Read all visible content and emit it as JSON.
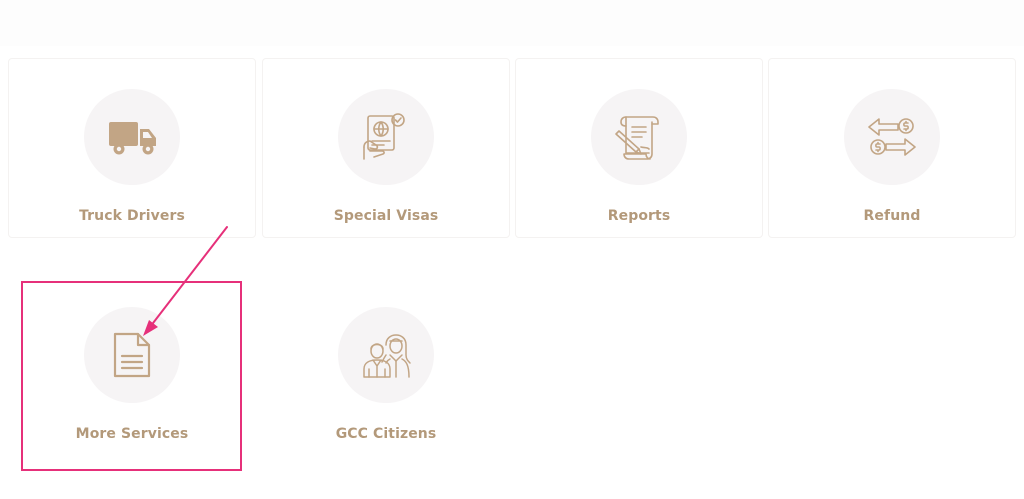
{
  "services": [
    {
      "label": "Truck Drivers",
      "icon": "truck-icon"
    },
    {
      "label": "Special Visas",
      "icon": "visa-document-icon"
    },
    {
      "label": "Reports",
      "icon": "report-scroll-icon"
    },
    {
      "label": "Refund",
      "icon": "refund-exchange-icon"
    },
    {
      "label": "More Services",
      "icon": "document-icon"
    },
    {
      "label": "GCC Citizens",
      "icon": "gcc-citizens-icon"
    }
  ],
  "colors": {
    "label": "#b3997a",
    "icon": "#c2a585",
    "icon_circle": "#f6f4f5",
    "highlight": "#e6307a"
  }
}
